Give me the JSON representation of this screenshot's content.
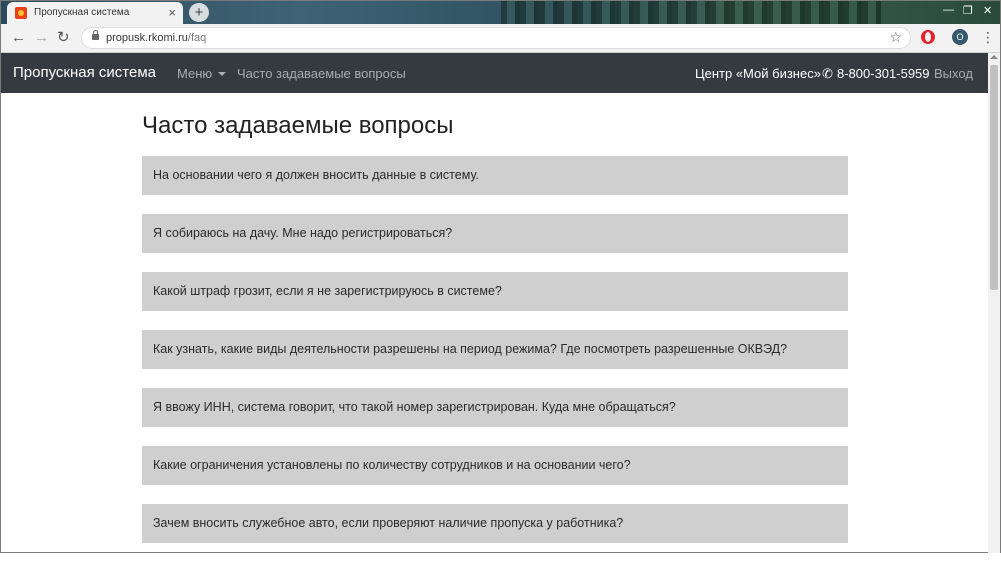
{
  "browser": {
    "tab_title": "Пропускная система",
    "tab_close": "×",
    "new_tab": "+",
    "url_domain": "propusk.rkomi.ru",
    "url_path": "/faq",
    "profile_initial": "O"
  },
  "navbar": {
    "brand": "Пропускная система",
    "menu_label": "Меню",
    "faq_link": "Часто задаваемые вопросы",
    "center": "Центр «Мой бизнес»",
    "phone": "8-800-301-5959",
    "logout": "Выход"
  },
  "page": {
    "title": "Часто задаваемые вопросы"
  },
  "faq": [
    "На основании чего я должен вносить данные в систему.",
    "Я собираюсь на дачу. Мне надо регистрироваться?",
    "Какой штраф грозит, если я не зарегистрируюсь в системе?",
    "Как узнать, какие виды деятельности разрешены на период режима? Где посмотреть разрешенные ОКВЭД?",
    "Я ввожу ИНН, система говорит, что такой номер зарегистрирован. Куда мне обращаться?",
    "Какие ограничения установлены по количеству сотрудников и на основании чего?",
    "Зачем вносить служебное авто, если проверяют наличие пропуска у работника?"
  ],
  "icons": {
    "tab_favicon": "site-favicon-icon",
    "back": "back-arrow-icon",
    "forward": "forward-arrow-icon",
    "reload": "reload-icon",
    "lock": "lock-icon",
    "star": "bookmark-star-icon",
    "opera": "opera-extension-icon",
    "menu": "kebab-menu-icon",
    "phone": "phone-icon",
    "caret": "caret-down-icon"
  },
  "colors": {
    "navbar_bg": "#343a40",
    "faq_item_bg": "#cfcfcf",
    "nav_link": "#a8adb2"
  }
}
